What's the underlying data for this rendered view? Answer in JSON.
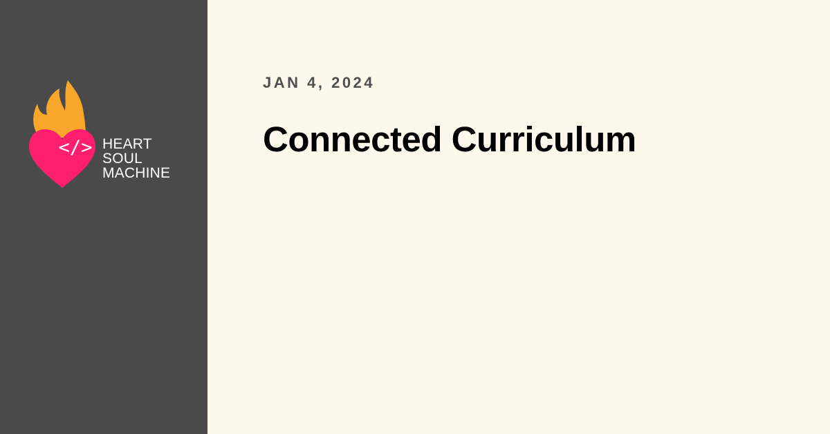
{
  "colors": {
    "sidebar_background": "#4a4a4a",
    "main_background": "#fdf7ec",
    "flame": "#f9a72b",
    "heart": "#ff1f6e",
    "logo_text": "#ffffff",
    "date_text": "#4f4f4f",
    "title_text": "#000000"
  },
  "brand": {
    "logo_icon": "flaming-heart-code-icon",
    "heart_glyph": "</>",
    "wordmark": [
      "HEART",
      "SOUL",
      "MACHINE"
    ]
  },
  "post": {
    "date": "JAN 4, 2024",
    "title": "Connected Curriculum"
  }
}
